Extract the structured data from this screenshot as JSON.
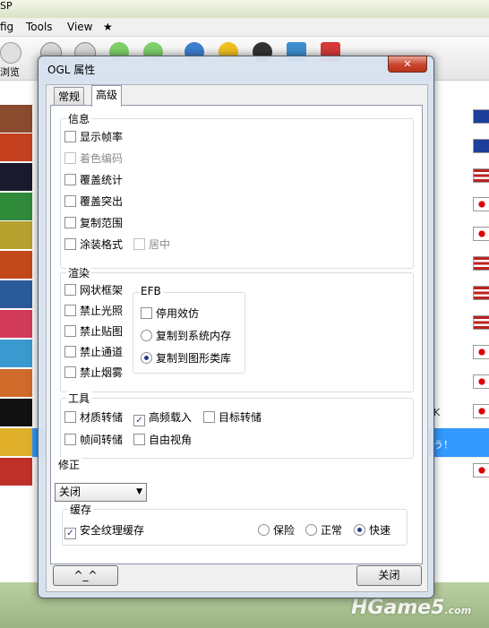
{
  "app": {
    "title_fragment": "SP",
    "menu": [
      "fig",
      "Tools",
      "View",
      "★"
    ],
    "toolbar_label": "浏览",
    "list_fragments": [
      "K",
      "う！"
    ]
  },
  "watermark": {
    "main": "HGame5",
    "suffix": ".com"
  },
  "dialog": {
    "title": "OGL 属性",
    "close_glyph": "✕",
    "tabs": [
      {
        "label": "常规",
        "active": false
      },
      {
        "label": "高级",
        "active": true
      }
    ],
    "info": {
      "title": "信息",
      "show_fps": "显示帧率",
      "shader_code": "着色编码",
      "overlay_stats": "覆盖统计",
      "overlay_highlight": "覆盖突出",
      "copy_range": "复制范围",
      "paint_format": "涂装格式",
      "center": "居中"
    },
    "render": {
      "title": "渲染",
      "wireframe": "网状框架",
      "disable_lighting": "禁止光照",
      "disable_textures": "禁止贴图",
      "disable_channels": "禁止通道",
      "disable_fog": "禁止烟雾",
      "efb": {
        "title": "EFB",
        "disable_effects": "停用效仿",
        "copy_to_ram": "复制到系统内存",
        "copy_to_texture": "复制到图形类库"
      }
    },
    "tools": {
      "title": "工具",
      "dump_textures": "材质转储",
      "hires_textures": "高频载入",
      "dump_targets": "目标转储",
      "dump_frames": "帧间转储",
      "free_look": "自由视角"
    },
    "fix": {
      "title": "修正",
      "selected": "关闭"
    },
    "cache": {
      "title": "缓存",
      "safe_texture_cache": "安全纹理缓存",
      "safe": "保险",
      "normal": "正常",
      "fast": "快速"
    },
    "buttons": {
      "about": "^_^",
      "close": "关闭"
    }
  }
}
